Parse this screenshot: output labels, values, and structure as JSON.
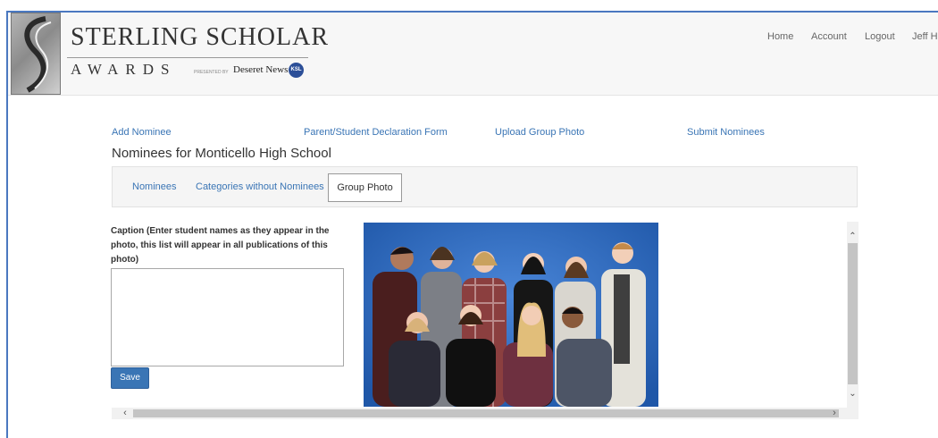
{
  "brand": {
    "title": "STERLING SCHOLAR",
    "subtitle": "AWARDS",
    "presented_by": "PRESENTED BY",
    "sponsor": "Deseret News",
    "sponsor_badge": "KSL"
  },
  "topnav": {
    "home": "Home",
    "account": "Account",
    "logout": "Logout",
    "user": "Jeff Hi"
  },
  "subnav": {
    "add_nominee": "Add Nominee",
    "declaration_form": "Parent/Student Declaration Form",
    "upload_group_photo": "Upload Group Photo",
    "submit_nominees": "Submit Nominees"
  },
  "page_title": "Nominees for Monticello High School",
  "tabs": {
    "nominees": "Nominees",
    "categories_without_nominees": "Categories without Nominees",
    "group_photo": "Group Photo"
  },
  "form": {
    "caption_label": "Caption (Enter student names as they appear in the photo, this list will appear in all publications of this photo)",
    "caption_value": "",
    "save_label": "Save"
  },
  "scroll": {
    "up": "⌃",
    "down": "⌄",
    "left": "‹",
    "right": "›"
  },
  "colors": {
    "link": "#3a75b5",
    "button": "#3a75b5",
    "photo_backdrop": "#2f6bc4"
  }
}
